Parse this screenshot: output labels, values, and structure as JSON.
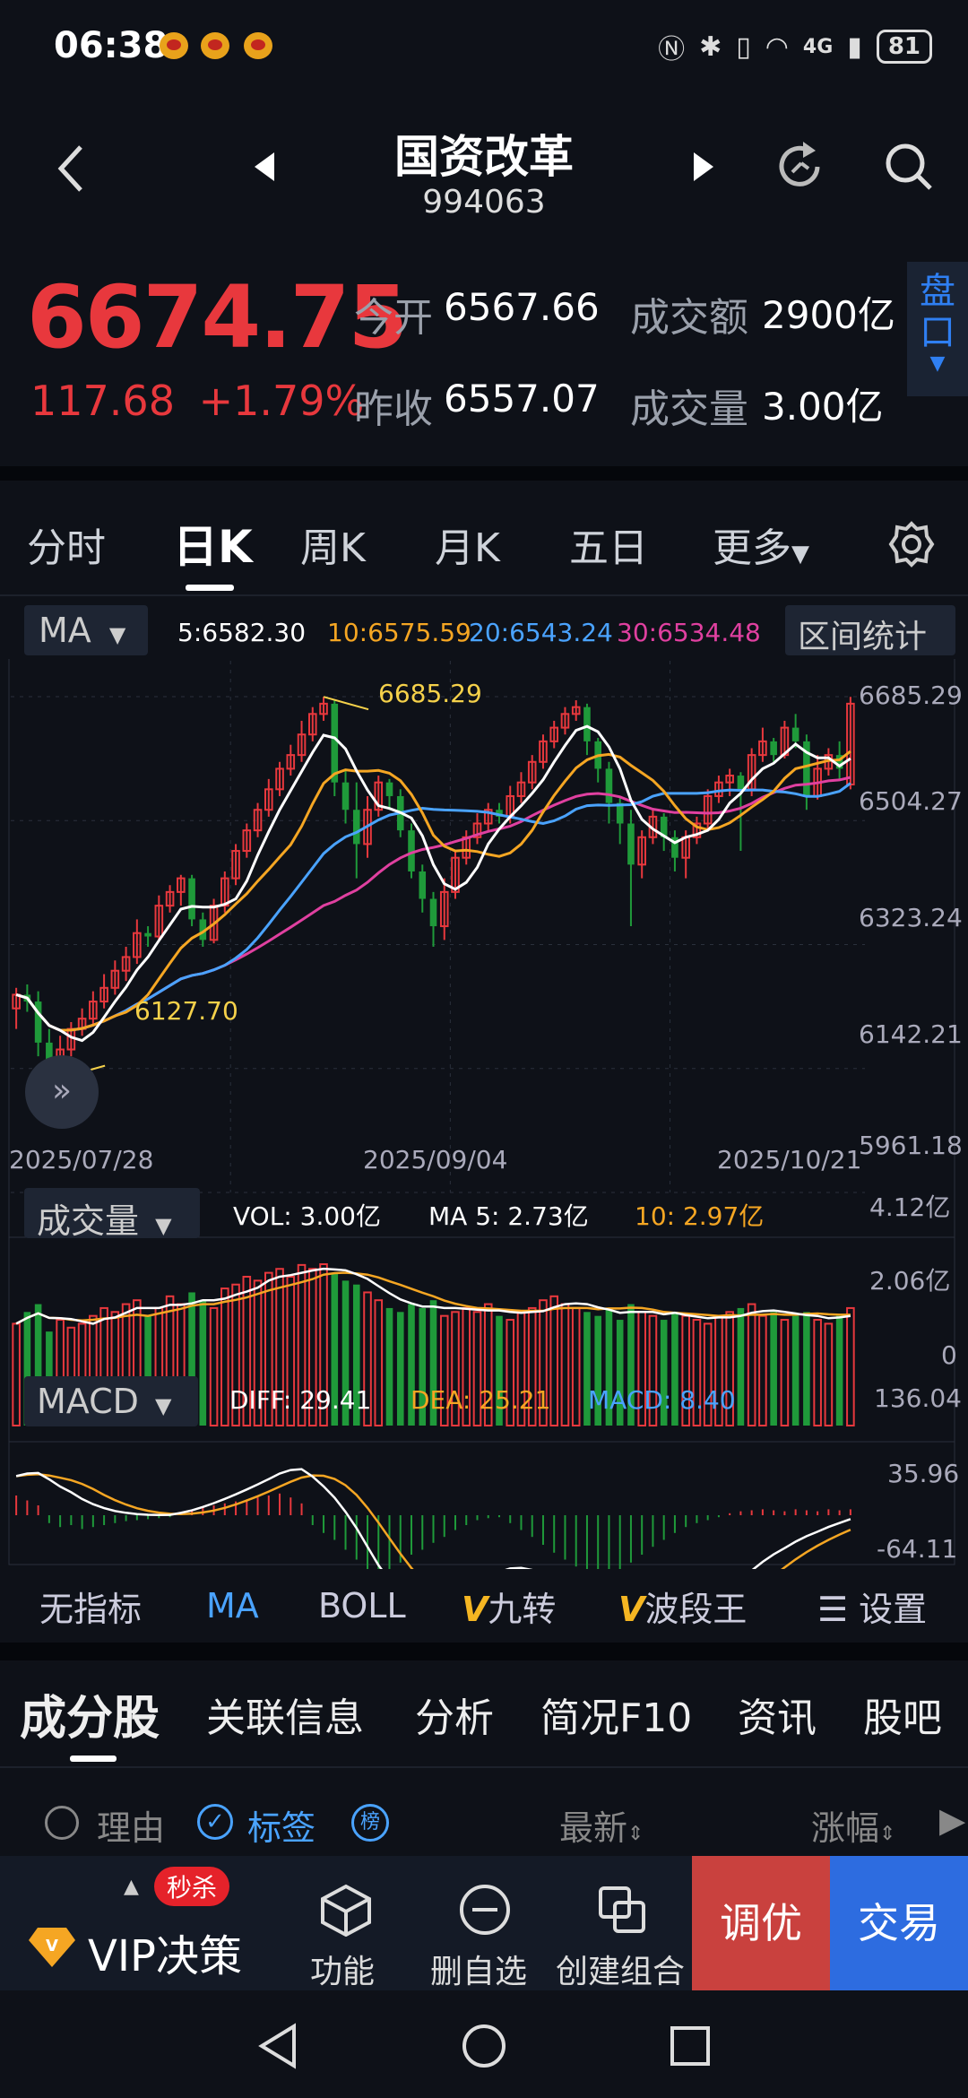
{
  "status_bar": {
    "time": "06:38",
    "network": "4G",
    "battery": "81"
  },
  "header": {
    "title": "国资改革",
    "code": "994063"
  },
  "quote": {
    "price": "6674.75",
    "change": "117.68",
    "change_pct": "+1.79%",
    "open_label": "今开",
    "open_value": "6567.66",
    "prev_close_label": "昨收",
    "prev_close_value": "6557.07",
    "turnover_label": "成交额",
    "turnover_value": "2900亿",
    "volume_label": "成交量",
    "volume_value": "3.00亿",
    "pankou_label": "盘口",
    "colors": {
      "up": "#e8383d",
      "down": "#1f9a3a"
    }
  },
  "period_tabs": [
    "分时",
    "日K",
    "周K",
    "月K",
    "五日",
    "更多"
  ],
  "active_period": "日K",
  "main_chart": {
    "indicator_select": "MA",
    "legend": {
      "ma5": "5:6582.30",
      "ma10": "10:6575.59",
      "ma20": "20:6543.24",
      "ma30": "30:6534.48"
    },
    "range_stats_button": "区间统计",
    "high_marker": "6685.29",
    "low_marker": "6127.70",
    "y_ticks": [
      "6685.29",
      "6504.27",
      "6323.24",
      "6142.21",
      "5961.18"
    ],
    "dates": [
      "2025/07/28",
      "2025/09/04",
      "2025/10/21"
    ]
  },
  "volume_chart": {
    "indicator_select": "成交量",
    "vol": "VOL: 3.00亿",
    "ma5": "MA 5: 2.73亿",
    "ma10": "10: 2.97亿",
    "y_ticks": [
      "4.12亿",
      "2.06亿",
      "0"
    ]
  },
  "macd_chart": {
    "indicator_select": "MACD",
    "diff": "DIFF: 29.41",
    "dea": "DEA: 25.21",
    "macd": "MACD: 8.40",
    "y_ticks": [
      "136.04",
      "35.96",
      "-64.11"
    ]
  },
  "chart_data": {
    "type": "candlestick",
    "y_range": [
      5961.18,
      6685.29
    ],
    "ma_colors": {
      "ma5": "#ffffff",
      "ma10": "#f5a623",
      "ma20": "#4aa3ff",
      "ma30": "#e040a0"
    },
    "candles": [
      [
        6230,
        6250,
        6200,
        6260
      ],
      [
        6250,
        6240,
        6225,
        6265
      ],
      [
        6240,
        6180,
        6160,
        6255
      ],
      [
        6180,
        6150,
        6130,
        6200
      ],
      [
        6150,
        6170,
        6128,
        6190
      ],
      [
        6170,
        6200,
        6160,
        6210
      ],
      [
        6200,
        6215,
        6190,
        6230
      ],
      [
        6215,
        6240,
        6205,
        6255
      ],
      [
        6240,
        6260,
        6230,
        6280
      ],
      [
        6260,
        6285,
        6250,
        6300
      ],
      [
        6285,
        6305,
        6270,
        6320
      ],
      [
        6305,
        6340,
        6295,
        6360
      ],
      [
        6340,
        6335,
        6320,
        6350
      ],
      [
        6335,
        6380,
        6330,
        6395
      ],
      [
        6380,
        6400,
        6370,
        6410
      ],
      [
        6400,
        6420,
        6380,
        6425
      ],
      [
        6420,
        6360,
        6350,
        6425
      ],
      [
        6360,
        6330,
        6320,
        6370
      ],
      [
        6330,
        6380,
        6325,
        6390
      ],
      [
        6380,
        6420,
        6370,
        6430
      ],
      [
        6420,
        6460,
        6410,
        6470
      ],
      [
        6460,
        6490,
        6450,
        6500
      ],
      [
        6490,
        6520,
        6480,
        6530
      ],
      [
        6520,
        6550,
        6510,
        6565
      ],
      [
        6550,
        6580,
        6540,
        6590
      ],
      [
        6580,
        6600,
        6570,
        6615
      ],
      [
        6600,
        6630,
        6590,
        6650
      ],
      [
        6630,
        6660,
        6620,
        6670
      ],
      [
        6660,
        6675,
        6650,
        6685
      ],
      [
        6675,
        6560,
        6540,
        6680
      ],
      [
        6560,
        6520,
        6500,
        6580
      ],
      [
        6520,
        6470,
        6420,
        6560
      ],
      [
        6470,
        6520,
        6450,
        6540
      ],
      [
        6520,
        6560,
        6510,
        6570
      ],
      [
        6560,
        6540,
        6520,
        6565
      ],
      [
        6540,
        6490,
        6480,
        6550
      ],
      [
        6490,
        6430,
        6420,
        6500
      ],
      [
        6430,
        6390,
        6370,
        6440
      ],
      [
        6390,
        6350,
        6320,
        6400
      ],
      [
        6350,
        6400,
        6330,
        6420
      ],
      [
        6400,
        6450,
        6390,
        6460
      ],
      [
        6450,
        6480,
        6440,
        6490
      ],
      [
        6480,
        6500,
        6470,
        6515
      ],
      [
        6500,
        6520,
        6490,
        6530
      ],
      [
        6520,
        6510,
        6500,
        6530
      ],
      [
        6510,
        6540,
        6500,
        6555
      ],
      [
        6540,
        6560,
        6530,
        6575
      ],
      [
        6560,
        6590,
        6550,
        6600
      ],
      [
        6590,
        6620,
        6580,
        6630
      ],
      [
        6620,
        6640,
        6610,
        6650
      ],
      [
        6640,
        6660,
        6630,
        6670
      ],
      [
        6660,
        6670,
        6650,
        6680
      ],
      [
        6670,
        6620,
        6600,
        6675
      ],
      [
        6620,
        6580,
        6560,
        6625
      ],
      [
        6580,
        6530,
        6500,
        6590
      ],
      [
        6530,
        6500,
        6470,
        6540
      ],
      [
        6500,
        6440,
        6350,
        6520
      ],
      [
        6440,
        6480,
        6420,
        6490
      ],
      [
        6480,
        6510,
        6470,
        6520
      ],
      [
        6510,
        6480,
        6460,
        6515
      ],
      [
        6480,
        6450,
        6430,
        6490
      ],
      [
        6450,
        6480,
        6420,
        6490
      ],
      [
        6480,
        6500,
        6470,
        6510
      ],
      [
        6500,
        6540,
        6490,
        6550
      ],
      [
        6540,
        6560,
        6530,
        6570
      ],
      [
        6560,
        6570,
        6540,
        6580
      ],
      [
        6570,
        6550,
        6460,
        6575
      ],
      [
        6550,
        6600,
        6540,
        6610
      ],
      [
        6600,
        6620,
        6590,
        6640
      ],
      [
        6620,
        6600,
        6590,
        6625
      ],
      [
        6600,
        6640,
        6595,
        6650
      ],
      [
        6640,
        6620,
        6610,
        6660
      ],
      [
        6620,
        6540,
        6520,
        6630
      ],
      [
        6540,
        6580,
        6535,
        6600
      ],
      [
        6580,
        6600,
        6570,
        6610
      ],
      [
        6600,
        6580,
        6565,
        6620
      ],
      [
        6557,
        6675,
        6550,
        6685
      ]
    ],
    "volumes": [
      2.6,
      2.9,
      3.1,
      2.4,
      2.7,
      2.5,
      2.6,
      2.8,
      3.0,
      2.9,
      3.1,
      3.2,
      2.8,
      3.0,
      3.3,
      3.1,
      3.4,
      3.2,
      3.0,
      3.5,
      3.6,
      3.8,
      3.7,
      3.9,
      4.0,
      3.8,
      4.1,
      4.0,
      4.12,
      3.9,
      3.7,
      3.6,
      3.4,
      3.2,
      3.0,
      2.9,
      3.1,
      3.0,
      3.2,
      2.8,
      2.9,
      3.0,
      2.9,
      3.1,
      2.8,
      2.7,
      2.9,
      3.0,
      3.2,
      3.3,
      3.1,
      3.0,
      2.9,
      2.8,
      3.0,
      2.7,
      3.1,
      2.9,
      2.8,
      2.7,
      2.9,
      2.8,
      2.7,
      2.6,
      2.8,
      2.9,
      3.0,
      3.1,
      2.8,
      2.9,
      2.7,
      2.8,
      2.9,
      2.7,
      2.6,
      2.8,
      3.0
    ],
    "macd_hist": [
      20,
      15,
      10,
      -8,
      -12,
      -10,
      -14,
      -12,
      -10,
      -8,
      -6,
      -5,
      -4,
      -3,
      -2,
      3,
      5,
      8,
      10,
      12,
      14,
      16,
      18,
      20,
      22,
      18,
      12,
      -10,
      -18,
      -25,
      -35,
      -45,
      -55,
      -60,
      -55,
      -48,
      -40,
      -35,
      -28,
      -22,
      -15,
      -10,
      -5,
      -3,
      -2,
      -8,
      -15,
      -22,
      -30,
      -38,
      -45,
      -52,
      -58,
      -62,
      -60,
      -55,
      -48,
      -40,
      -32,
      -25,
      -18,
      -12,
      -8,
      -5,
      -2,
      2,
      4,
      5,
      6,
      5,
      4,
      6,
      5,
      4,
      6,
      5,
      6
    ]
  },
  "indicator_bar": [
    "无指标",
    "MA",
    "BOLL",
    "九转",
    "波段王",
    "设置"
  ],
  "sub_tabs": [
    "成分股",
    "关联信息",
    "分析",
    "简况F10",
    "资讯",
    "股吧"
  ],
  "list_header": {
    "reason": "理由",
    "tag": "标签",
    "badge": "榜",
    "latest": "最新",
    "change": "涨幅"
  },
  "bottom_bar": {
    "vip_badge": "秒杀",
    "vip_label": "VIP决策",
    "func": "功能",
    "remove": "删自选",
    "combo": "创建组合",
    "optimize": "调优",
    "trade": "交易"
  }
}
